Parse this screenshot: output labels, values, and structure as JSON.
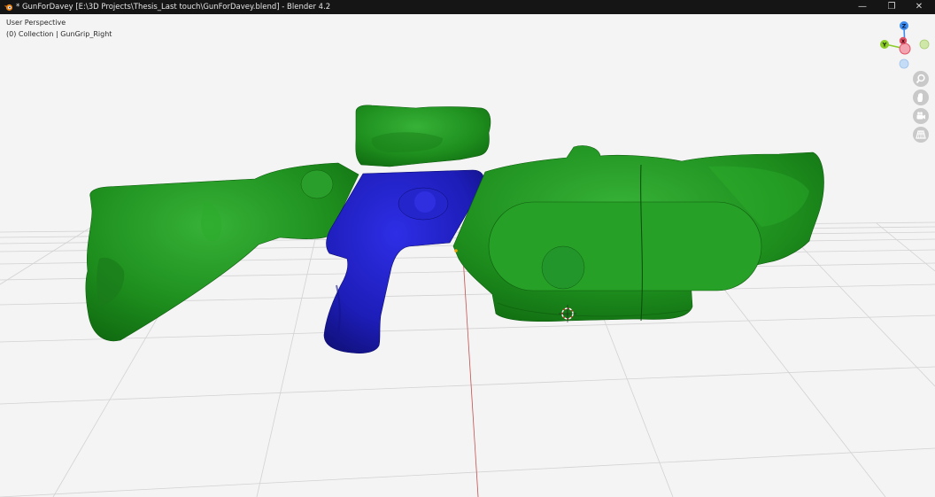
{
  "window": {
    "title": "* GunForDavey [E:\\3D Projects\\Thesis_Last touch\\GunForDavey.blend] - Blender 4.2",
    "minimize": "—",
    "maximize": "❐",
    "close": "✕"
  },
  "viewport": {
    "view_name": "User Perspective",
    "collection_line": "(0) Collection | GunGrip_Right"
  },
  "gizmo": {
    "axis_z": "Z",
    "axis_y": "Y",
    "axis_x": "X"
  },
  "nav_buttons": [
    {
      "icon": "zoom-icon"
    },
    {
      "icon": "hand-pan-icon"
    },
    {
      "icon": "camera-icon"
    },
    {
      "icon": "grid-perspective-icon"
    }
  ],
  "colors": {
    "mesh_green": "#1f8a1f",
    "mesh_selected_blue": "#1f1fb0",
    "background": "#f4f4f4",
    "axis_x_red": "#e05064",
    "axis_y_green": "#8ccc28",
    "axis_z_blue": "#3c8cf0"
  }
}
